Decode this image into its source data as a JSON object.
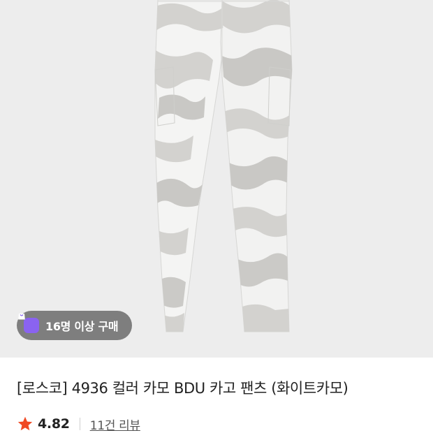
{
  "product": {
    "image_icon": "camo-cargo-pants-photo",
    "badge": {
      "icon": "shopping-bag-icon",
      "text": "16명 이상 구매",
      "icon_color": "#8a63f0"
    },
    "title": "[로스코] 4936 컬러 카모 BDU 카고 팬츠 (화이트카모)",
    "rating": {
      "icon": "star-icon",
      "value": "4.82",
      "star_color": "#f04923"
    },
    "reviews_label": "11건 리뷰"
  }
}
